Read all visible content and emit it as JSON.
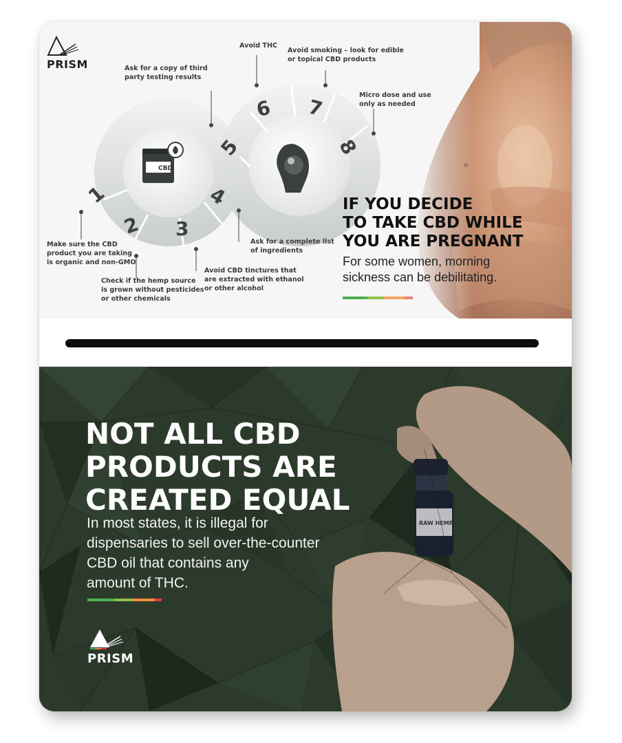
{
  "top_panel": {
    "brand": "PRISM",
    "headline_lines": [
      "IF YOU DECIDE",
      "TO TAKE CBD WHILE",
      "YOU ARE PREGNANT"
    ],
    "subtext_lines": [
      "For some women, morning",
      "sickness can be debilitating."
    ],
    "jar_label": "CBD",
    "steps": [
      {
        "number": "1",
        "lines": [
          "Make sure the CBD",
          "product you are taking",
          "is organic and non-GMO"
        ]
      },
      {
        "number": "2",
        "lines": [
          "Check if the hemp source",
          "is grown without pesticides",
          "or other chemicals"
        ]
      },
      {
        "number": "3",
        "lines": [
          "Avoid CBD tinctures that",
          "are extracted with ethanol",
          "or other alcohol"
        ]
      },
      {
        "number": "4",
        "lines": [
          "Ask for a complete list",
          "of ingredients"
        ]
      },
      {
        "number": "5",
        "lines": [
          "Ask for a copy of third",
          "party testing results"
        ]
      },
      {
        "number": "6",
        "lines": [
          "Avoid THC"
        ]
      },
      {
        "number": "7",
        "lines": [
          "Avoid smoking – look for edible",
          "or topical CBD products"
        ]
      },
      {
        "number": "8",
        "lines": [
          "Micro dose and use",
          "only as needed"
        ]
      }
    ]
  },
  "bottom_panel": {
    "brand": "PRISM",
    "headline_lines": [
      "NOT ALL CBD",
      "PRODUCTS ARE",
      "CREATED EQUAL"
    ],
    "subtext_lines": [
      "In most states, it is illegal for",
      "dispensaries to sell over-the-counter",
      "CBD oil that contains any",
      "amount of THC."
    ],
    "bottle_label": "RAW HEMP"
  },
  "colors": {
    "accent_green": "#4caf50",
    "accent_olive": "#8bc34a",
    "accent_orange": "#f08c3c",
    "accent_red": "#e53935",
    "dark_green_bg": "#2c3a2c"
  },
  "icons": [
    "prism-logo-icon",
    "cbd-jar-icon",
    "pregnancy-icon",
    "dropper-bottle-icon"
  ]
}
